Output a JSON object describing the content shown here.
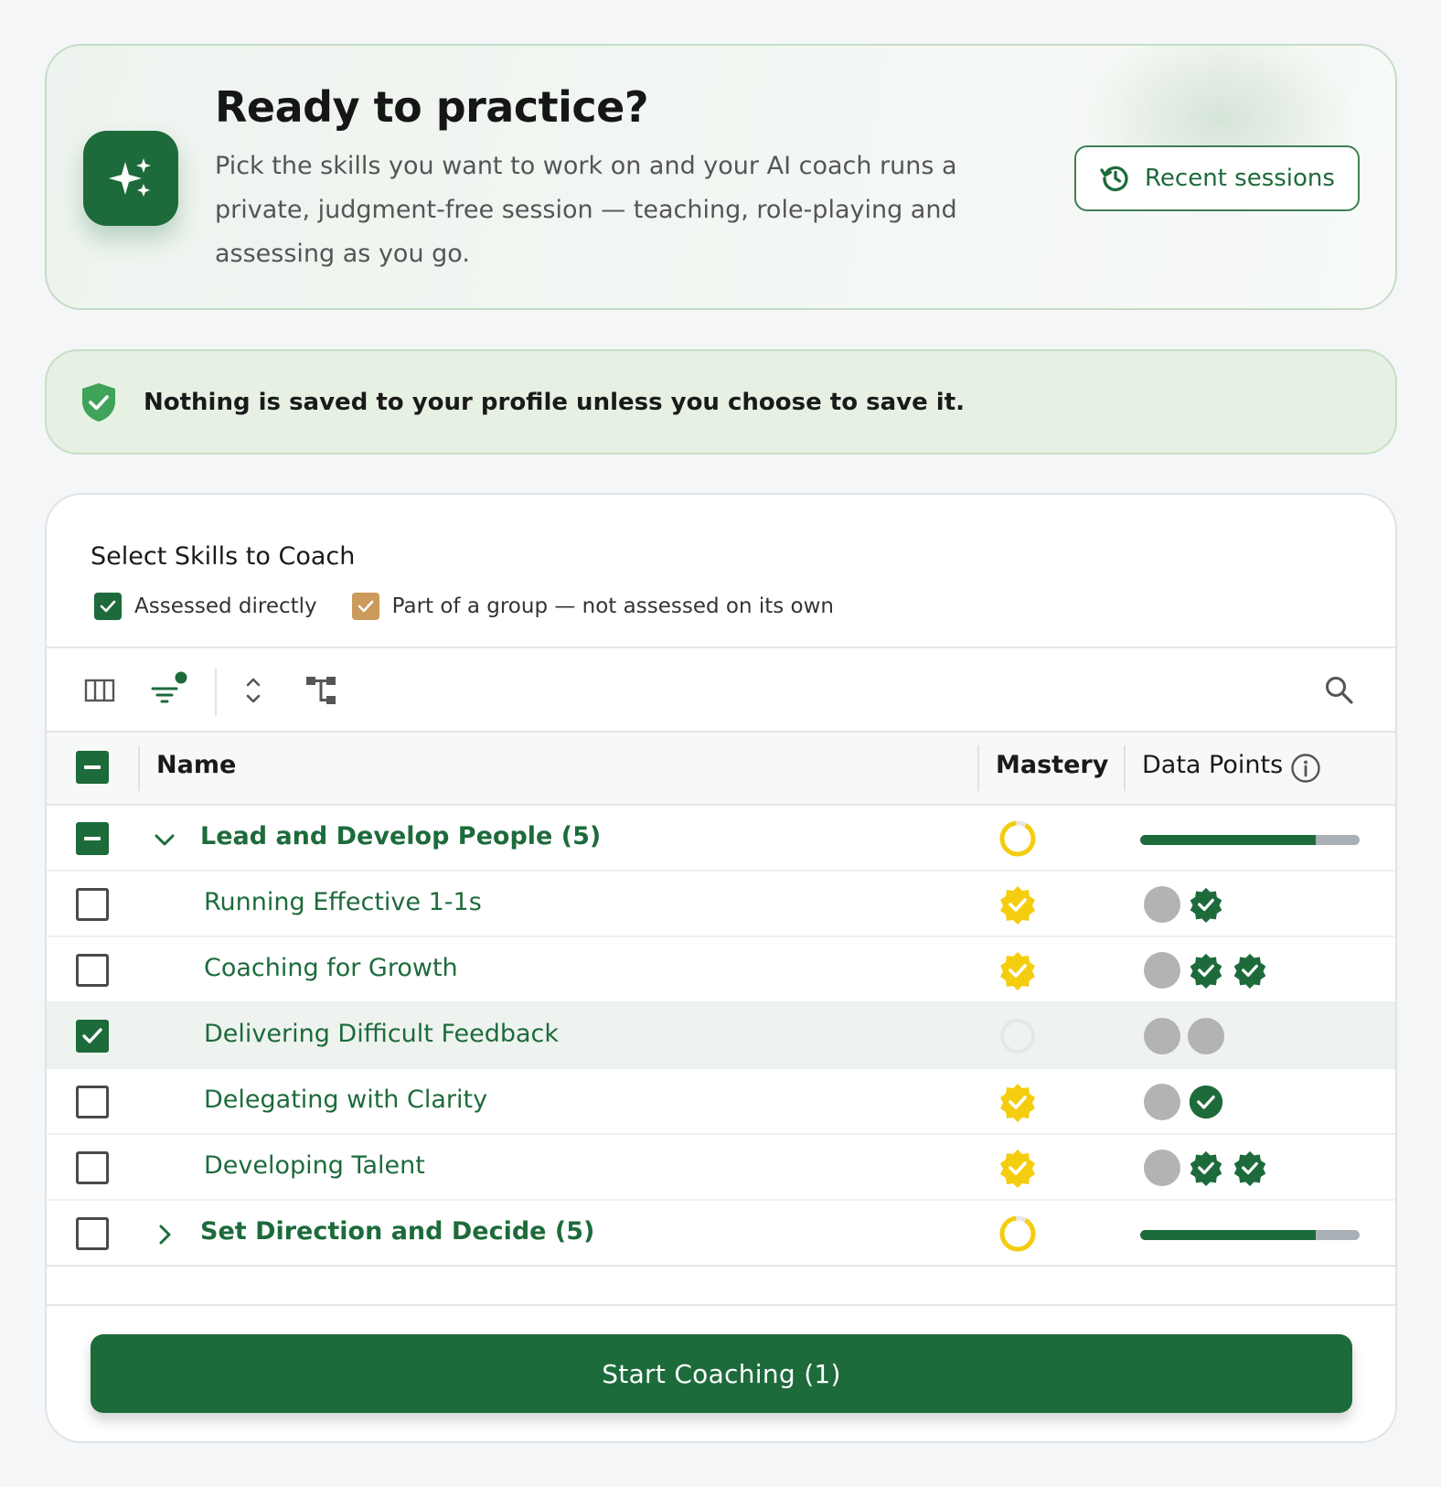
{
  "hero": {
    "icon": "sparkles-icon",
    "title": "Ready to practice?",
    "description": "Pick the skills you want to work on and your AI coach runs a private, judgment-free session — teaching, role-playing and assessing as you go.",
    "recent_button": {
      "label": "Recent sessions",
      "icon": "history-icon"
    }
  },
  "privacy": {
    "icon": "shield-check-icon",
    "message": "Nothing is saved to your profile unless you choose to save it."
  },
  "skills": {
    "title": "Select Skills to Coach",
    "legend": [
      {
        "label": "Assessed directly",
        "color": "#1d6b3b"
      },
      {
        "label": "Part of a group — not assessed on its own",
        "color": "#cc9a5a"
      }
    ],
    "toolbar": [
      "columns-icon",
      "filter-icon",
      "expand-collapse-icon",
      "tree-icon",
      "search-icon"
    ],
    "columns": {
      "name": "Name",
      "mastery": "Mastery",
      "data_points": "Data Points"
    },
    "rows": [
      {
        "type": "group",
        "name": "Lead and Develop People (5)",
        "checkbox": "indeterminate",
        "expanded": true,
        "mastery": "partial-ring",
        "data_points_progress": 0.8
      },
      {
        "type": "skill",
        "name": "Running Effective 1-1s",
        "checkbox": "unchecked",
        "mastery": "mastered",
        "data_points": [
          "pending",
          "badge"
        ]
      },
      {
        "type": "skill",
        "name": "Coaching for Growth",
        "checkbox": "unchecked",
        "mastery": "mastered",
        "data_points": [
          "pending",
          "badge",
          "badge"
        ]
      },
      {
        "type": "skill",
        "name": "Delivering Difficult Feedback",
        "checkbox": "checked",
        "mastery": "none",
        "data_points": [
          "pending",
          "pending"
        ]
      },
      {
        "type": "skill",
        "name": "Delegating with Clarity",
        "checkbox": "unchecked",
        "mastery": "mastered",
        "data_points": [
          "pending",
          "check"
        ]
      },
      {
        "type": "skill",
        "name": "Developing Talent",
        "checkbox": "unchecked",
        "mastery": "mastered",
        "data_points": [
          "pending",
          "badge",
          "badge"
        ]
      },
      {
        "type": "group",
        "name": "Set Direction and Decide (5)",
        "checkbox": "unchecked",
        "expanded": false,
        "mastery": "partial-ring",
        "data_points_progress": 0.8
      }
    ],
    "start_button": "Start Coaching (1)"
  },
  "colors": {
    "brand": "#1d6b3b",
    "mastery_gold": "#f5cd0f",
    "pending_grey": "#b3b3b3"
  }
}
